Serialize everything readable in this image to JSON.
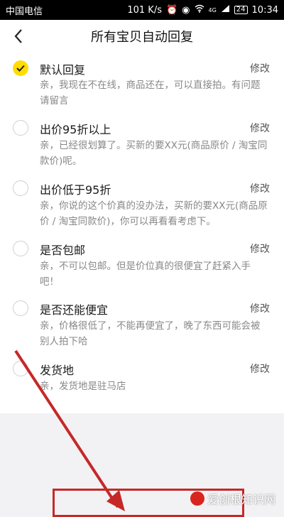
{
  "status_bar": {
    "carrier": "中国电信",
    "speed": "101 K/s",
    "network": "4G",
    "battery": "24",
    "time": "10:34"
  },
  "header": {
    "title": "所有宝贝自动回复"
  },
  "edit_label": "修改",
  "replies": [
    {
      "title": "默认回复",
      "desc": "亲，我现在不在线，商品还在，可以直接拍。有问题请留言",
      "checked": true
    },
    {
      "title": "出价95折以上",
      "desc": "亲，已经很划算了。买新的要XX元(商品原价 / 淘宝同款价)呢。",
      "checked": false
    },
    {
      "title": "出价低于95折",
      "desc": "亲，你说的这个价真的没办法，买新的要XX元(商品原价 / 淘宝同款价)，你可以再看看考虑下。",
      "checked": false
    },
    {
      "title": "是否包邮",
      "desc": "亲，不可以包邮。但是价位真的很便宜了赶紧入手吧！",
      "checked": false
    },
    {
      "title": "是否还能便宜",
      "desc": "亲，价格很低了，不能再便宜了，晚了东西可能会被别人拍下哈",
      "checked": false
    },
    {
      "title": "发货地",
      "desc": "亲，发货地是驻马店",
      "checked": false
    }
  ],
  "colors": {
    "accent": "#ffdd00",
    "annotation": "#c62828"
  },
  "icons": {
    "back": "chevron-left-icon",
    "check": "check-icon"
  },
  "watermark": {
    "text": "爱创根知识网"
  }
}
